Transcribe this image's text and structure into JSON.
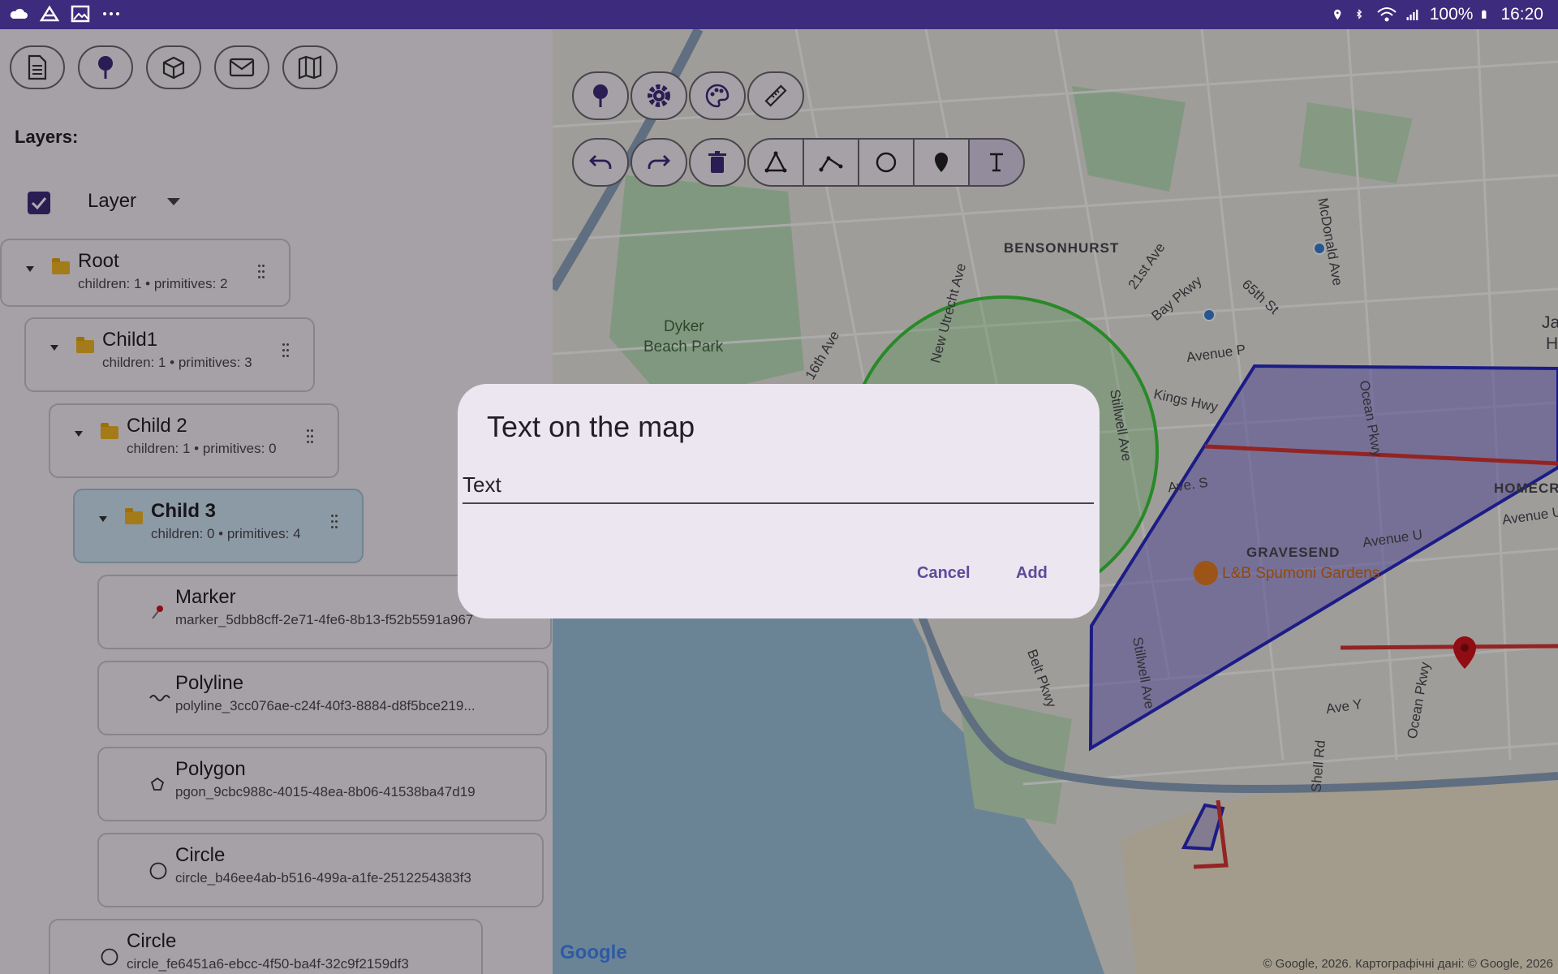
{
  "status_bar": {
    "battery": "100%",
    "time": "16:20"
  },
  "layers": {
    "label": "Layers:",
    "layer_select_value": "Layer",
    "tree": [
      {
        "name": "Root",
        "info": "children: 1 • primitives: 2"
      },
      {
        "name": "Child1",
        "info": "children: 1 • primitives: 3"
      },
      {
        "name": "Child 2",
        "info": "children: 1 • primitives: 0"
      },
      {
        "name": "Child 3",
        "info": "children: 0 • primitives: 4"
      }
    ],
    "primitives": [
      {
        "type": "Marker",
        "id": "marker_5dbb8cff-2e71-4fe6-8b13-f52b5591a967"
      },
      {
        "type": "Polyline",
        "id": "polyline_3cc076ae-c24f-40f3-8884-d8f5bce219..."
      },
      {
        "type": "Polygon",
        "id": "pgon_9cbc988c-4015-48ea-8b06-41538ba47d19"
      },
      {
        "type": "Circle",
        "id": "circle_b46ee4ab-b516-499a-a1fe-2512254383f3"
      },
      {
        "type": "Circle",
        "id": "circle_fe6451a6-ebcc-4f50-ba4f-32c9f2159df3"
      }
    ]
  },
  "map": {
    "labels": {
      "bensonhurst": "BENSONHURST",
      "dyker": "Dyker",
      "beach_park": "Beach Park",
      "gravesend": "GRAVESEND",
      "spumoni": "L&B Spumoni Gardens",
      "homecrest": "HOMECR",
      "avenue_p": "Avenue P",
      "avenue_u": "Avenue U",
      "ave_s": "Ave. S",
      "ave_y": "Ave Y",
      "kings_hwy": "Kings Hwy",
      "bay_pkwy": "Bay Pkwy",
      "st65": "65th St",
      "ave21": "21st Ave",
      "ave16": "16th Ave",
      "new_utrecht": "New Utrecht Ave",
      "stillwell": "Stillwell Ave",
      "stillwell2": "Stillwell Ave",
      "ocean_pkwy": "Ocean Pkwy",
      "ocean_pkwy2": "Ocean Pkwy",
      "mcdonald": "McDonald Ave",
      "shell_rd": "Shell Rd",
      "avenue_u2": "Avenue U",
      "james": "James",
      "hi": "Hi",
      "belt_pkwy": "Belt Pkwy"
    },
    "copyright": "© Google, 2026. Картографічні дані: © Google, 2026",
    "google_logo": "Google"
  },
  "dialog": {
    "title": "Text on the map",
    "input_value": "Text",
    "cancel_label": "Cancel",
    "add_label": "Add"
  },
  "colors": {
    "accent": "#3d2b7d",
    "dialog_button": "#5d4a9a",
    "polygon_fill": "#7b6fd9",
    "polygon_stroke": "#2a2ac8",
    "polyline": "#d93535",
    "circle_stroke": "#3ccb3c",
    "marker": "#d3141c"
  }
}
